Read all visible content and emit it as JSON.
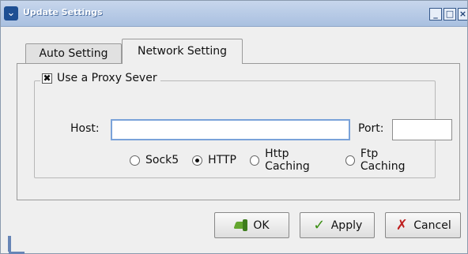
{
  "window": {
    "title": "Update Settings"
  },
  "tabs": [
    {
      "label": "Auto Setting"
    },
    {
      "label": "Network Setting"
    }
  ],
  "proxy": {
    "checkbox_label": "Use a Proxy Sever",
    "checked": true,
    "host_label": "Host:",
    "host_value": "",
    "port_label": "Port:",
    "port_value": ""
  },
  "proxy_types": [
    {
      "label": "Sock5",
      "selected": false
    },
    {
      "label": "HTTP",
      "selected": true
    },
    {
      "label": "Http Caching",
      "selected": false
    },
    {
      "label": "Ftp Caching",
      "selected": false
    }
  ],
  "buttons": {
    "ok": "OK",
    "apply": "Apply",
    "cancel": "Cancel"
  },
  "icons": {
    "window_menu": "chevron-down-icon",
    "minimize": "minimize-icon",
    "maximize": "maximize-icon",
    "close": "close-icon",
    "ok": "hand-icon",
    "apply": "check-icon",
    "cancel": "x-icon"
  },
  "colors": {
    "titlebar": "#a9c0e0",
    "focus_border": "#7aa2d9",
    "apply_check": "#3b8f13",
    "cancel_x": "#bf1f1f"
  }
}
